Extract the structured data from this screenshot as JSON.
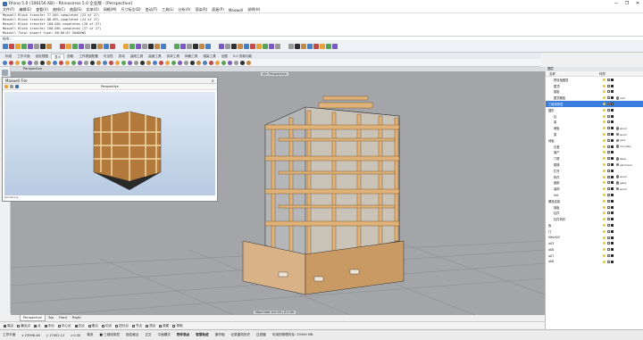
{
  "app": {
    "title": "Rhino 5.0 (106156 KB) - Rhinoceros 5.0 企业版 - [Perspective]",
    "controls": [
      "—",
      "❐",
      "✕"
    ]
  },
  "menu": [
    "文件(F)",
    "编辑(E)",
    "查看(V)",
    "曲线(C)",
    "曲面(S)",
    "实体(O)",
    "网格(M)",
    "尺寸标注(D)",
    "变动(T)",
    "工具(L)",
    "分析(A)",
    "渲染(R)",
    "面板(P)",
    "Maxwell",
    "说明(H)"
  ],
  "command_history": [
    "Maxwell Block transfer 77.50% completed (23 of 27)",
    "Maxwell Block transfer 88.89% completed (24 of 27)",
    "Maxwell Block transfer 100.00% completed (26 of 27)",
    "Maxwell Block transfer 100.00% completed (27 of 27)",
    "Maxwell Total export time: 00:00:07 SHADOWS"
  ],
  "command_prompt": "指令:",
  "toolbar_tabs": [
    "标准",
    "工作平面",
    "设定视图",
    "显示",
    "选取",
    "工作视窗配置",
    "可见性",
    "变动",
    "曲线工具",
    "曲面工具",
    "实体工具",
    "网格工具",
    "渲染工具",
    "出图",
    "5.0 的新功能"
  ],
  "active_toolbar_tab": "显示",
  "viewport": {
    "tab_label": "Perspective",
    "title": "Viz: Perspective",
    "coord_readout": "Max:Orbit X:0.00 | Z:0.00"
  },
  "maxwell_window": {
    "title": "Maxwell Fire",
    "caption": "Perspective",
    "status": "Rendering..."
  },
  "view_tabs": [
    "Perspective",
    "Top",
    "Front",
    "Right"
  ],
  "active_view_tab": "Perspective",
  "osnap": [
    {
      "label": "端点",
      "on": true
    },
    {
      "label": "最近点",
      "on": false
    },
    {
      "label": "点",
      "on": true
    },
    {
      "label": "中点",
      "on": true
    },
    {
      "label": "中心点",
      "on": false
    },
    {
      "label": "交点",
      "on": true
    },
    {
      "label": "垂点",
      "on": false
    },
    {
      "label": "切点",
      "on": false
    },
    {
      "label": "四分点",
      "on": false
    },
    {
      "label": "节点",
      "on": false
    },
    {
      "label": "顶点",
      "on": false
    },
    {
      "label": "投影",
      "on": false
    },
    {
      "label": "停用",
      "on": false
    }
  ],
  "status": {
    "plane": "工作平面",
    "x": "x 23996.46",
    "y": "y 17002.12",
    "z": "z 0.00",
    "units": "毫米",
    "layer": "■ 三维线条层",
    "snap": "锁定格点",
    "ortho": "正交",
    "planar": "平面模式",
    "osnap": "物件锁点",
    "smarttrack": "智慧轨迹",
    "gumball": "操作轴",
    "history": "记录建构历史",
    "filter": "过滤器",
    "memory": "可用的物理内存: 29549 MB"
  },
  "layers_panel": {
    "tab": "图层",
    "col_name": "名称",
    "col_material": "材质",
    "rows": [
      {
        "name": "预设值图层",
        "indent": 1,
        "selected": false,
        "mat": ""
      },
      {
        "name": "屋顶",
        "indent": 1,
        "selected": false,
        "mat": ""
      },
      {
        "name": "楼板",
        "indent": 1,
        "selected": false,
        "mat": ""
      },
      {
        "name": "屋顶楼板",
        "indent": 1,
        "selected": false,
        "mat": "roof"
      },
      {
        "name": "三维线条层",
        "indent": 0,
        "selected": true,
        "mat": ""
      },
      {
        "name": "圆形",
        "indent": 0,
        "selected": false,
        "mat": ""
      },
      {
        "name": "柱",
        "indent": 1,
        "selected": false,
        "mat": ""
      },
      {
        "name": "梁",
        "indent": 1,
        "selected": false,
        "mat": ""
      },
      {
        "name": "墙板",
        "indent": 1,
        "selected": false,
        "mat": "wood"
      },
      {
        "name": "梁",
        "indent": 1,
        "selected": false,
        "mat": "wood"
      },
      {
        "name": "地板",
        "indent": 0,
        "selected": false,
        "mat": "pine"
      },
      {
        "name": "石基",
        "indent": 1,
        "selected": false,
        "mat": "concrete"
      },
      {
        "name": "窗户",
        "indent": 1,
        "selected": false,
        "mat": ""
      },
      {
        "name": "门框",
        "indent": 1,
        "selected": false,
        "mat": "steel"
      },
      {
        "name": "楼梯",
        "indent": 1,
        "selected": false,
        "mat": "aluminum"
      },
      {
        "name": "栏杆",
        "indent": 1,
        "selected": false,
        "mat": ""
      },
      {
        "name": "构件",
        "indent": 1,
        "selected": false,
        "mat": "wood"
      },
      {
        "name": "细部",
        "indent": 1,
        "selected": false,
        "mat": "glass"
      },
      {
        "name": "装饰",
        "indent": 1,
        "selected": false,
        "mat": "wood"
      },
      {
        "name": "Vet",
        "indent": 1,
        "selected": false,
        "mat": ""
      },
      {
        "name": "螺栓连接",
        "indent": 0,
        "selected": false,
        "mat": ""
      },
      {
        "name": "钢板",
        "indent": 1,
        "selected": false,
        "mat": ""
      },
      {
        "name": "柱件",
        "indent": 1,
        "selected": false,
        "mat": ""
      },
      {
        "name": "柱件构件",
        "indent": 1,
        "selected": false,
        "mat": ""
      },
      {
        "name": "板",
        "indent": 0,
        "selected": false,
        "mat": ""
      },
      {
        "name": "门",
        "indent": 0,
        "selected": false,
        "mat": ""
      },
      {
        "name": "Mesh03",
        "indent": 0,
        "selected": false,
        "mat": ""
      },
      {
        "name": "a03",
        "indent": 0,
        "selected": false,
        "mat": ""
      },
      {
        "name": "a06",
        "indent": 0,
        "selected": false,
        "mat": ""
      },
      {
        "name": "a07",
        "indent": 0,
        "selected": false,
        "mat": ""
      },
      {
        "name": "a08",
        "indent": 0,
        "selected": false,
        "mat": ""
      }
    ]
  },
  "colors": {
    "accent": "#3b7ddd",
    "wood": "#d9a96b",
    "viewport_bg": "#a3a5a8"
  }
}
